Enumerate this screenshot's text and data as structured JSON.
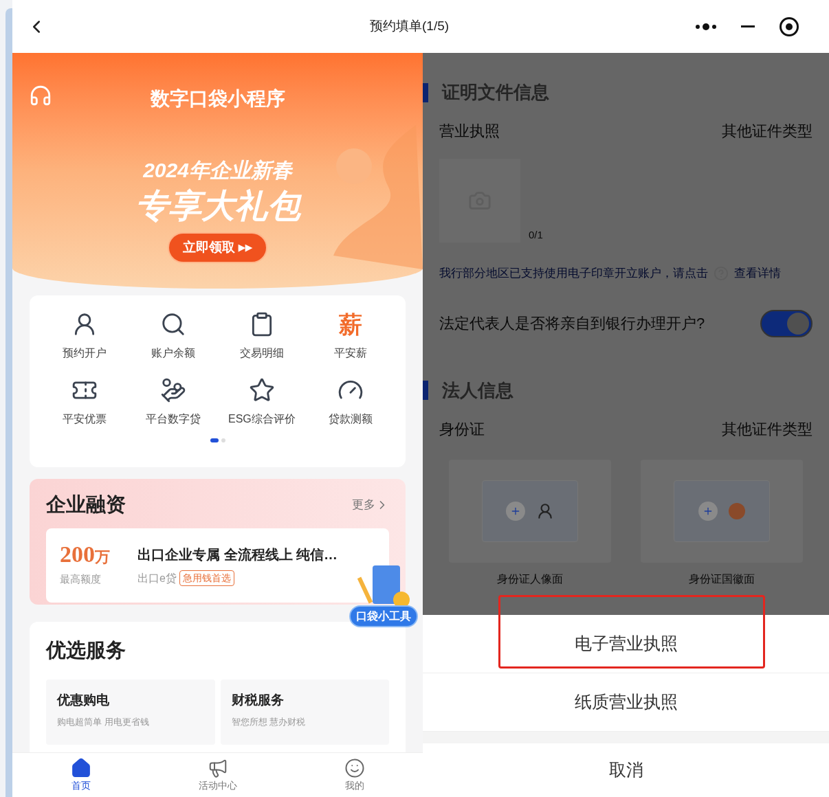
{
  "top_bar": {
    "title": "预约填单(1/5)"
  },
  "banner": {
    "title": "数字口袋小程序",
    "headline_1": "2024年企业新春",
    "headline_2": "专享大礼包",
    "cta": "立即领取",
    "cta_arrows": "▸▸"
  },
  "shortcuts": {
    "items": [
      {
        "label": "预约开户"
      },
      {
        "label": "账户余额"
      },
      {
        "label": "交易明细"
      },
      {
        "label": "平安薪",
        "glyph": "薪"
      },
      {
        "label": "平安优票"
      },
      {
        "label": "平台数字贷"
      },
      {
        "label": "ESG综合评价"
      },
      {
        "label": "贷款测额"
      }
    ],
    "pages": [
      {
        "selected": true
      },
      {
        "selected": false
      }
    ]
  },
  "financing": {
    "title": "企业融资",
    "more": "更多",
    "product": {
      "amount": "200",
      "unit": "万",
      "amount_label": "最高额度",
      "name": "出口企业专属 全流程线上 纯信…",
      "product_name": "出口e贷",
      "badge": "急用钱首选"
    }
  },
  "floating_tool": {
    "label": "口袋小工具"
  },
  "services": {
    "title": "优选服务",
    "cards": [
      {
        "title": "优惠购电",
        "subtitle": "购电超简单 用电更省钱"
      },
      {
        "title": "财税服务",
        "subtitle": "智您所想 慧办财税"
      }
    ]
  },
  "bottom_nav": [
    {
      "label": "首页",
      "selected": true
    },
    {
      "label": "活动中心",
      "selected": false
    },
    {
      "label": "我的",
      "selected": false
    }
  ],
  "form": {
    "certificate": {
      "title": "证明文件信息",
      "doc_type": "营业执照",
      "other_type": "其他证件类型",
      "upload_count": "0/1",
      "notice": "我行部分地区已支持使用电子印章开立账户，请点击",
      "notice_link": "查看详情",
      "question": "法定代表人是否将亲自到银行办理开户?",
      "on": true
    },
    "legal_person": {
      "title": "法人信息",
      "doc_type": "身份证",
      "other_type": "其他证件类型",
      "uploads": [
        {
          "label": "身份证人像面"
        },
        {
          "label": "身份证国徽面"
        }
      ]
    }
  },
  "action_sheet": {
    "options": [
      {
        "label": "电子营业执照",
        "highlighted": true
      },
      {
        "label": "纸质营业执照",
        "highlighted": false
      }
    ],
    "cancel": "取消"
  }
}
